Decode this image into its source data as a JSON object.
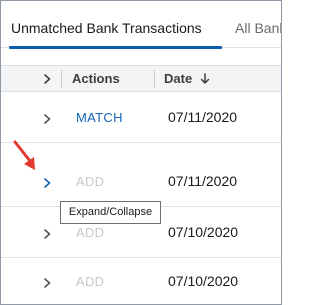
{
  "tabs": [
    {
      "label": "Unmatched Bank Transactions",
      "active": true
    },
    {
      "label": "All Bank",
      "active": false
    }
  ],
  "table": {
    "columns": {
      "actions": "Actions",
      "date": "Date"
    },
    "rows": [
      {
        "action": "MATCH",
        "action_enabled": true,
        "date": "07/11/2020"
      },
      {
        "action": "ADD",
        "action_enabled": false,
        "date": "07/11/2020"
      },
      {
        "action": "ADD",
        "action_enabled": false,
        "date": "07/10/2020"
      },
      {
        "action": "ADD",
        "action_enabled": false,
        "date": "07/10/2020"
      }
    ]
  },
  "tooltip": {
    "text": "Expand/Collapse"
  },
  "colors": {
    "accent": "#0b5cab",
    "link": "#1464b3",
    "disabled": "#c9c9c9",
    "header_bg": "#f3f4f6",
    "annotation_arrow": "#e03a2f"
  },
  "icons": {
    "expand": "chevron-right-icon",
    "sort": "arrow-down-icon",
    "annotation": "red-arrow-icon"
  }
}
